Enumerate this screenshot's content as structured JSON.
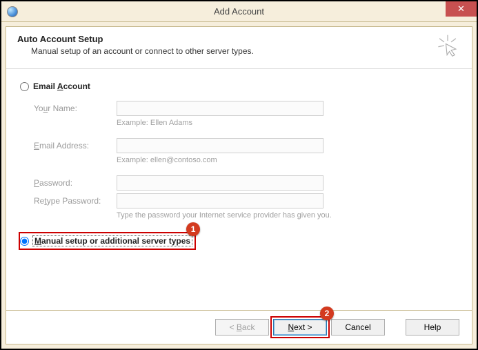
{
  "title": "Add Account",
  "header": {
    "title": "Auto Account Setup",
    "subtitle": "Manual setup of an account or connect to other server types."
  },
  "radios": {
    "email_label_pre": "Email ",
    "email_label_u": "A",
    "email_label_post": "ccount",
    "manual_label_pre": "",
    "manual_label_u": "M",
    "manual_label_post": "anual setup or additional server types"
  },
  "fields": {
    "name_label_pre": "Yo",
    "name_label_u": "u",
    "name_label_post": "r Name:",
    "name_value": "",
    "name_helper": "Example: Ellen Adams",
    "email_label_pre": "",
    "email_label_u": "E",
    "email_label_post": "mail Address:",
    "email_value": "",
    "email_helper": "Example: ellen@contoso.com",
    "pass_label_pre": "",
    "pass_label_u": "P",
    "pass_label_post": "assword:",
    "pass_value": "",
    "retype_label_pre": "Re",
    "retype_label_u": "t",
    "retype_label_post": "ype Password:",
    "retype_value": "",
    "pass_helper": "Type the password your Internet service provider has given you."
  },
  "buttons": {
    "back_pre": "< ",
    "back_u": "B",
    "back_post": "ack",
    "next_pre": "",
    "next_u": "N",
    "next_post": "ext >",
    "cancel": "Cancel",
    "help": "Help"
  },
  "callouts": {
    "one": "1",
    "two": "2"
  }
}
